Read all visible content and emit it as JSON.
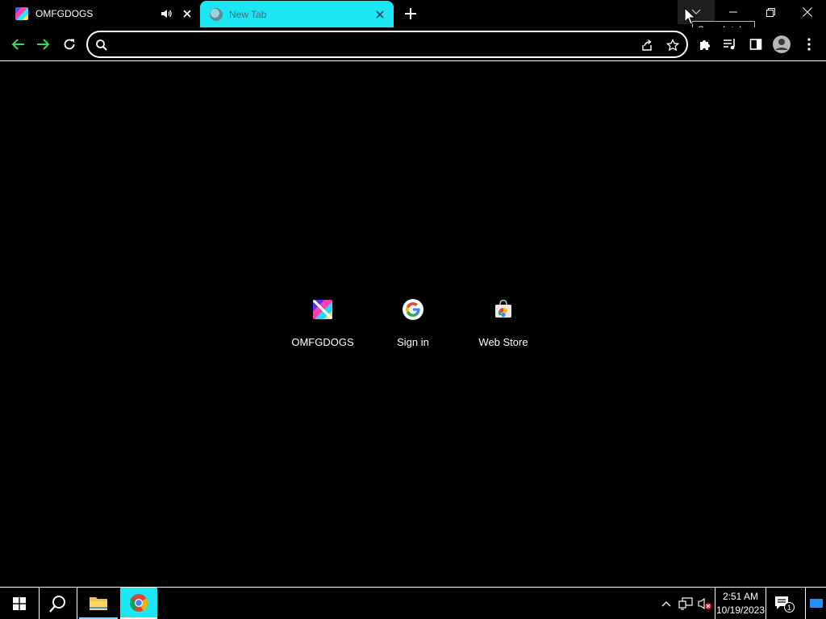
{
  "tabs": [
    {
      "title": "OMFGDOGS",
      "favicon": "omfgdogs-favicon",
      "audio": "speaker-icon",
      "active": false
    },
    {
      "title": "New Tab",
      "favicon": "globe-icon",
      "active": true
    }
  ],
  "titlebar": {
    "tooltip": "Search tabs",
    "buttons": [
      "search-tabs",
      "minimize",
      "restore",
      "close"
    ]
  },
  "toolbar": {
    "omnibox_value": "",
    "omnibox_placeholder": "",
    "icons": [
      "back",
      "forward",
      "reload",
      "share",
      "bookmark-star",
      "extensions",
      "media-control",
      "side-panel",
      "profile",
      "menu"
    ]
  },
  "shortcuts": [
    {
      "label": "OMFGDOGS",
      "icon": "omfgdogs-icon"
    },
    {
      "label": "Sign in",
      "icon": "google-icon"
    },
    {
      "label": "Web Store",
      "icon": "web-store-icon"
    }
  ],
  "taskbar": {
    "apps": [
      "start",
      "search",
      "file-explorer",
      "chrome"
    ],
    "time": "2:51 AM",
    "date": "10/19/2023",
    "notification_count": "1"
  },
  "colors": {
    "accent": "#1de6f4",
    "nav_arrow": "#3ddc4c",
    "background": "#000000",
    "foreground": "#ffffff"
  }
}
